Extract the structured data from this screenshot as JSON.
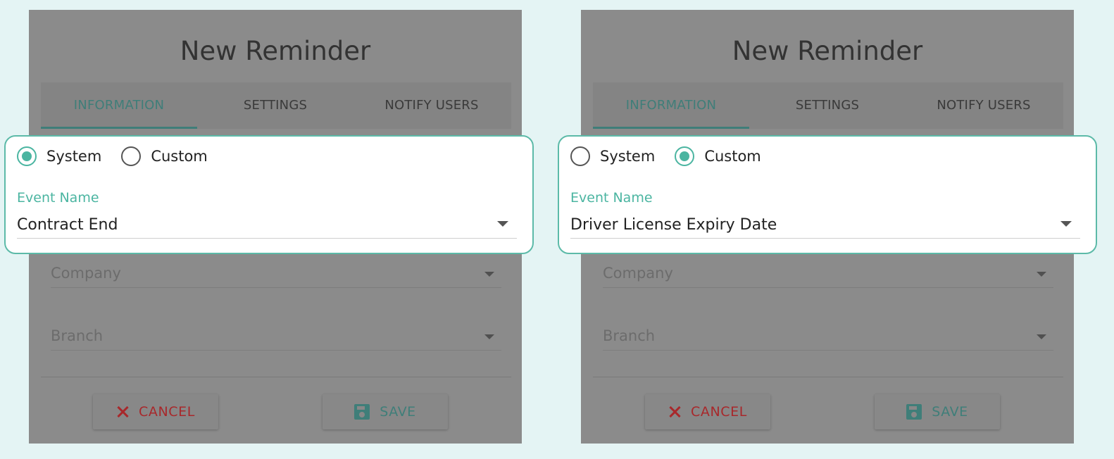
{
  "panels": [
    {
      "title": "New Reminder",
      "tabs": [
        "INFORMATION",
        "SETTINGS",
        "NOTIFY USERS"
      ],
      "fields": {
        "company": "Company",
        "branch": "Branch"
      },
      "buttons": {
        "cancel": "CANCEL",
        "save": "SAVE"
      },
      "radios": {
        "system": "System",
        "custom": "Custom",
        "selected": "System"
      },
      "event_label": "Event Name",
      "event_value": "Contract End"
    },
    {
      "title": "New Reminder",
      "tabs": [
        "INFORMATION",
        "SETTINGS",
        "NOTIFY USERS"
      ],
      "fields": {
        "company": "Company",
        "branch": "Branch"
      },
      "buttons": {
        "cancel": "CANCEL",
        "save": "SAVE"
      },
      "radios": {
        "system": "System",
        "custom": "Custom",
        "selected": "Custom"
      },
      "event_label": "Event Name",
      "event_value": "Driver License Expiry Date"
    }
  ],
  "colors": {
    "accent": "#4bb5a1",
    "cancel": "#a8282b",
    "overlay": "#8b8b8b",
    "background": "#e4f4f4"
  }
}
